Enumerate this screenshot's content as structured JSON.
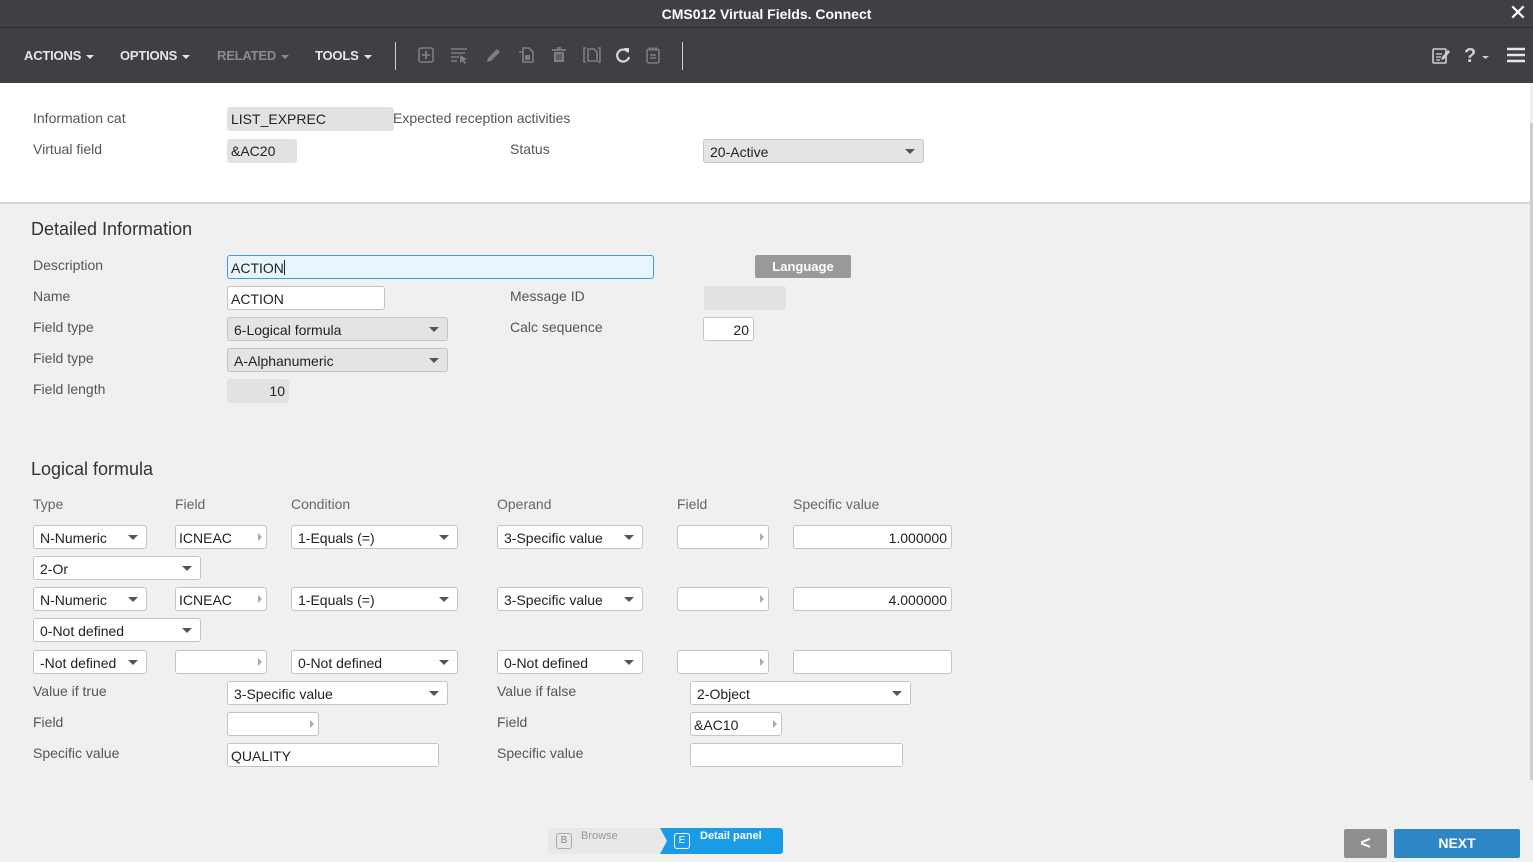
{
  "window": {
    "title": "CMS012 Virtual Fields. Connect",
    "close_icon": "close-icon"
  },
  "toolbar": {
    "menus": [
      {
        "label": "ACTIONS",
        "enabled": true
      },
      {
        "label": "OPTIONS",
        "enabled": true
      },
      {
        "label": "RELATED",
        "enabled": false
      },
      {
        "label": "TOOLS",
        "enabled": true
      }
    ],
    "icons": [
      "new-icon",
      "select-icon",
      "edit-icon",
      "copy-icon",
      "delete-icon",
      "display-icon",
      "refresh-icon",
      "notes-icon"
    ],
    "right_icons": [
      "personalize-icon",
      "help-icon",
      "hamburger-menu-icon"
    ]
  },
  "header": {
    "info_cat_label": "Information cat",
    "info_cat_value": "LIST_EXPREC",
    "info_cat_desc": "Expected reception activities",
    "virtual_field_label": "Virtual field",
    "virtual_field_value": "&AC20",
    "status_label": "Status",
    "status_value": "20-Active"
  },
  "detail": {
    "title": "Detailed Information",
    "description_label": "Description",
    "description_value": "ACTION",
    "language_button": "Language",
    "name_label": "Name",
    "name_value": "ACTION",
    "message_id_label": "Message ID",
    "message_id_value": "",
    "field_type_label": "Field type",
    "field_type_value": "6-Logical formula",
    "calc_seq_label": "Calc sequence",
    "calc_seq_value": "20",
    "field_type2_label": "Field type",
    "field_type2_value": "A-Alphanumeric",
    "field_length_label": "Field length",
    "field_length_value": "10"
  },
  "formula": {
    "title": "Logical formula",
    "columns": {
      "type": "Type",
      "field": "Field",
      "condition": "Condition",
      "operand": "Operand",
      "field2": "Field",
      "specific": "Specific value"
    },
    "rows": [
      {
        "type": "N-Numeric",
        "field": "ICNEAC",
        "condition": "1-Equals (=)",
        "operand": "3-Specific value",
        "field2": "",
        "specific": "1.000000"
      },
      {
        "type": "N-Numeric",
        "field": "ICNEAC",
        "condition": "1-Equals (=)",
        "operand": "3-Specific value",
        "field2": "",
        "specific": "4.000000"
      },
      {
        "type": "-Not defined",
        "field": "",
        "condition": "0-Not defined",
        "operand": "0-Not defined",
        "field2": "",
        "specific": ""
      }
    ],
    "connectors": [
      "2-Or",
      "0-Not defined"
    ],
    "true_label": "Value if true",
    "true_value": "3-Specific value",
    "true_field_label": "Field",
    "true_field_value": "",
    "true_specific_label": "Specific value",
    "true_specific_value": "QUALITY",
    "false_label": "Value if false",
    "false_value": "2-Object",
    "false_field_label": "Field",
    "false_field_value": "&AC10",
    "false_specific_label": "Specific value",
    "false_specific_value": ""
  },
  "footer": {
    "browse_key": "B",
    "browse_label": "Browse",
    "detail_key": "E",
    "detail_label": "Detail panel",
    "back_icon": "chevron-left-icon",
    "next_label": "NEXT"
  },
  "colors": {
    "toolbar_bg": "#3f4045",
    "focus_border": "#3d9be0",
    "active_panel": "#1a9be6",
    "next_button": "#2f86c6"
  }
}
